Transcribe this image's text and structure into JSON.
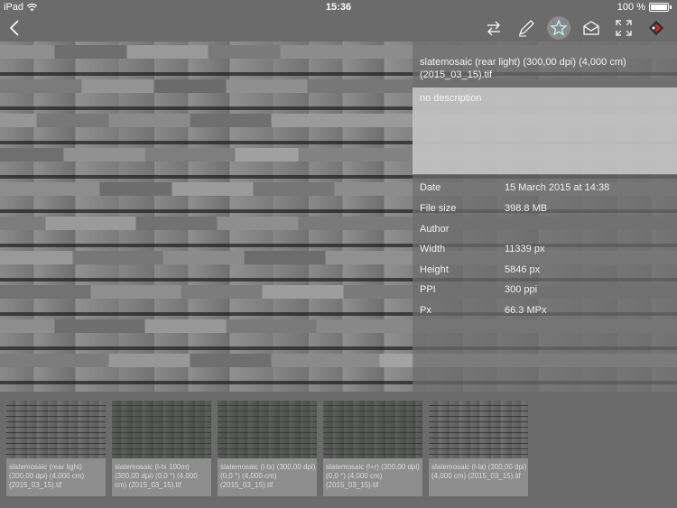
{
  "status_bar": {
    "device": "iPad",
    "time": "15:36",
    "battery": "100 %"
  },
  "navbar": {
    "back_icon": "chevron-left-icon",
    "icons": [
      "swap-arrows-icon",
      "pen-icon",
      "star-icon",
      "mail-icon",
      "fullscreen-icon",
      "app-logo-icon"
    ],
    "accent_color": "#d42a2a"
  },
  "info": {
    "title": "slatemosaic (rear light) (300,00 dpi) (4,000 cm) (2015_03_15).tif",
    "description": "no description",
    "meta": [
      {
        "label": "Date",
        "value": "15 March 2015 at 14:38"
      },
      {
        "label": "File size",
        "value": "398.8 MB"
      },
      {
        "label": "Author",
        "value": ""
      },
      {
        "label": "Width",
        "value": "11339 px"
      },
      {
        "label": "Height",
        "value": "5846 px"
      },
      {
        "label": "PPI",
        "value": "300 ppi"
      },
      {
        "label": "Px",
        "value": "66.3 MPx"
      }
    ]
  },
  "thumbnails": [
    {
      "label": "slatemosaic (rear light) (300,00 dpi) (4,000 cm) (2015_03_15).tif"
    },
    {
      "label": "slatemosaic (l-tx 100m) (300,00 dpi) (0,0 °) (4,000 cm) (2015_03_15).tif"
    },
    {
      "label": "slatemosaic (l-tx) (300,00 dpi) (0,0 °) (4,000 cm) (2015_03_15).tif"
    },
    {
      "label": "slatemosaic (l+r) (300,00 dpi) (0,0 °) (4,000 cm) (2015_03_15).tif"
    },
    {
      "label": "slatemosaic (l-la) (300,00 dpi) (4,000 cm) (2015_03_15).tif"
    }
  ]
}
